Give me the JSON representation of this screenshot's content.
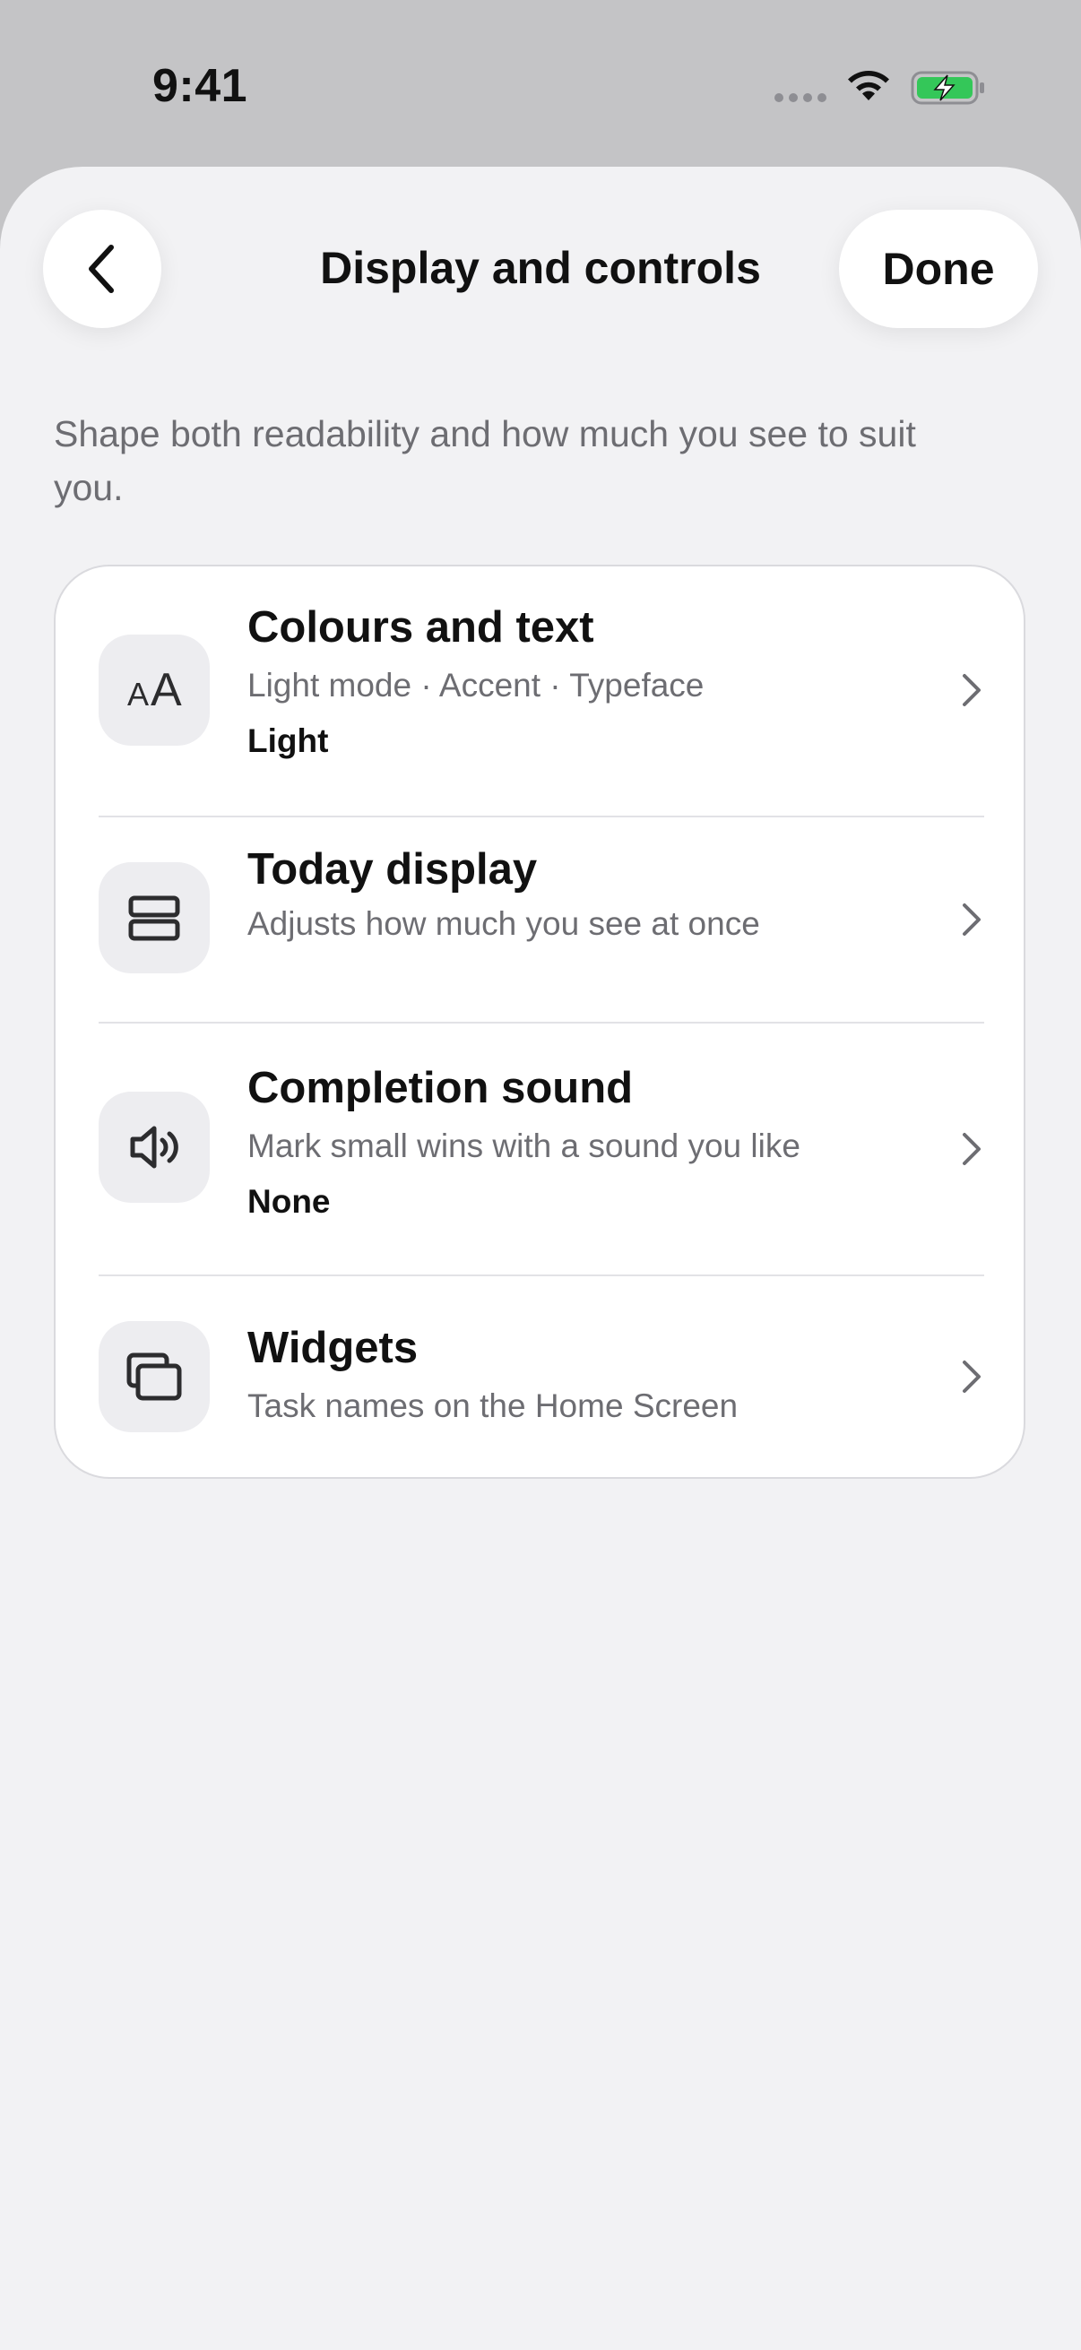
{
  "status_bar": {
    "time": "9:41"
  },
  "nav": {
    "title": "Display and controls",
    "done_label": "Done"
  },
  "description": "Shape both readability and how much you see to suit you.",
  "settings": [
    {
      "icon": "text-size-icon",
      "icon_text": "AA",
      "title": "Colours and text",
      "subtitle": "Light mode · Accent · Typeface",
      "value": "Light"
    },
    {
      "icon": "layout-rows-icon",
      "title": "Today display",
      "subtitle": "Adjusts how much you see at once"
    },
    {
      "icon": "speaker-icon",
      "title": "Completion sound",
      "subtitle": "Mark small wins with a sound you like",
      "value": "None"
    },
    {
      "icon": "widgets-icon",
      "title": "Widgets",
      "subtitle": "Task names on the Home Screen"
    }
  ],
  "colors": {
    "sheet_background": "#f2f2f4",
    "card_background": "#ffffff",
    "primary_text": "#111111",
    "secondary_text": "#6d6d72",
    "battery_green": "#34c759"
  }
}
